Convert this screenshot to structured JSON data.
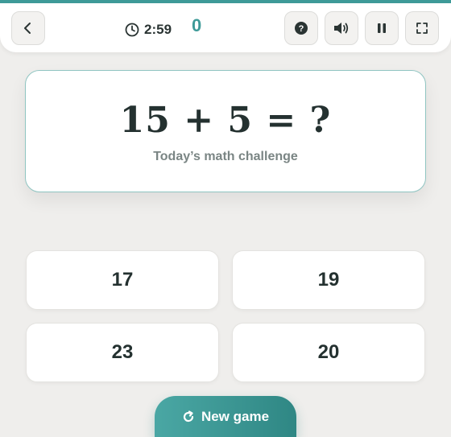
{
  "colors": {
    "accent": "#3e9a98",
    "text": "#243130",
    "muted": "#7a8584"
  },
  "header": {
    "back_icon": "chevron-left-icon",
    "timer_icon": "clock-icon",
    "timer": "2:59",
    "score": "0",
    "help_icon": "question-icon",
    "sound_icon": "speaker-icon",
    "pause_icon": "pause-icon",
    "fullscreen_icon": "fullscreen-icon"
  },
  "question": {
    "equation": "15 + 5 = ?",
    "subtitle": "Today’s math challenge"
  },
  "answers": [
    "17",
    "19",
    "23",
    "20"
  ],
  "new_game": {
    "label": "New game",
    "icon": "refresh-icon"
  }
}
